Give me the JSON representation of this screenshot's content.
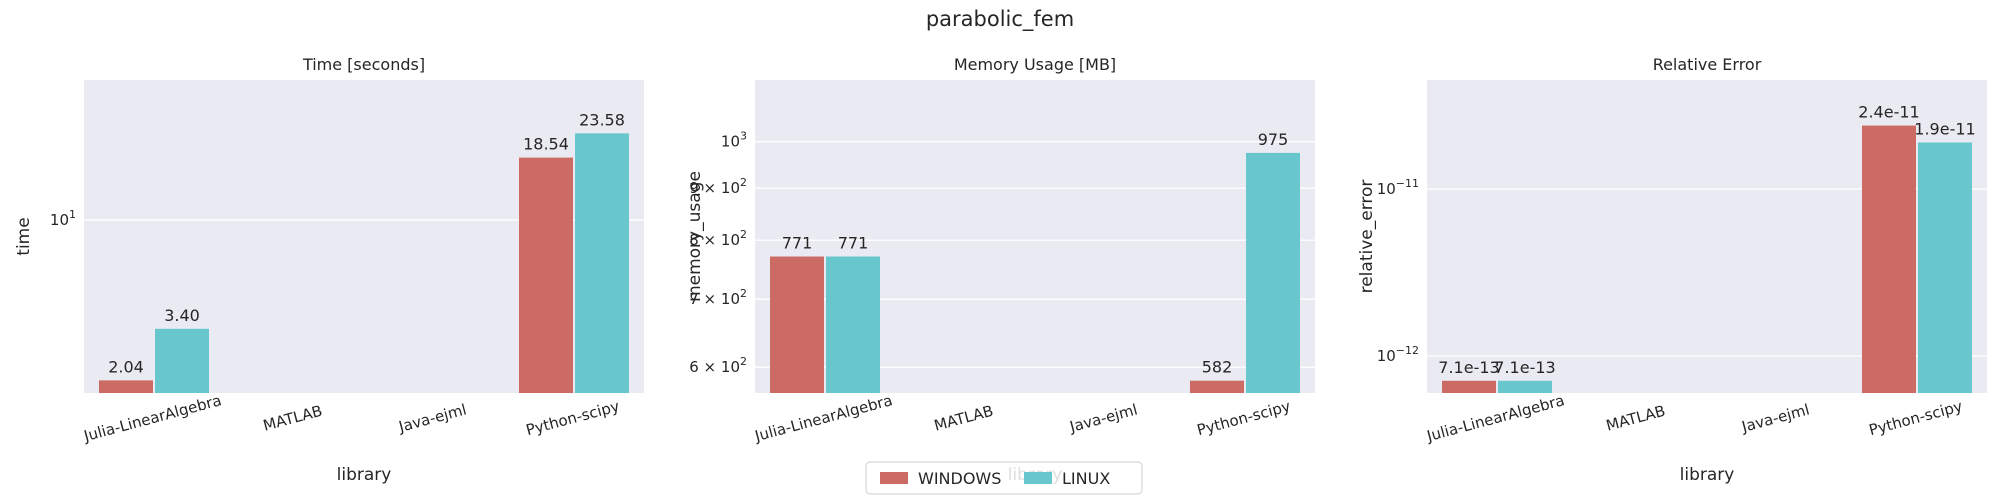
{
  "figure": {
    "suptitle": "parabolic_fem",
    "legend": {
      "placement": "bottom-center",
      "entries": [
        "WINDOWS",
        "LINUX"
      ]
    }
  },
  "colors": {
    "WINDOWS": "#cb6b63",
    "LINUX": "#67c7cc",
    "panel_bg": "#eaeaf2",
    "grid": "#ffffff"
  },
  "chart_data": [
    {
      "type": "bar",
      "title": "Time [seconds]",
      "xlabel": "library",
      "ylabel": "time",
      "yscale": "log",
      "categories": [
        "Julia-LinearAlgebra",
        "MATLAB",
        "Java-ejml",
        "Python-scipy"
      ],
      "series": [
        {
          "name": "WINDOWS",
          "values": [
            2.04,
            null,
            null,
            18.54
          ],
          "labels": [
            "2.04",
            "",
            "",
            "18.54"
          ]
        },
        {
          "name": "LINUX",
          "values": [
            3.4,
            null,
            null,
            23.58
          ],
          "labels": [
            "3.40",
            "",
            "",
            "23.58"
          ]
        }
      ],
      "yticks": [
        {
          "value": 10,
          "base": "10",
          "exp": "1"
        }
      ],
      "ylim": [
        1.8,
        40
      ],
      "grid": true
    },
    {
      "type": "bar",
      "title": "Memory Usage [MB]",
      "xlabel": "library",
      "ylabel": "memory_usage",
      "yscale": "log",
      "categories": [
        "Julia-LinearAlgebra",
        "MATLAB",
        "Java-ejml",
        "Python-scipy"
      ],
      "series": [
        {
          "name": "WINDOWS",
          "values": [
            771,
            null,
            null,
            582
          ],
          "labels": [
            "771",
            "",
            "",
            "582"
          ]
        },
        {
          "name": "LINUX",
          "values": [
            771,
            null,
            null,
            975
          ],
          "labels": [
            "771",
            "",
            "",
            "975"
          ]
        }
      ],
      "yticks": [
        {
          "value": 600,
          "base": "6 × 10",
          "exp": "2"
        },
        {
          "value": 700,
          "base": "7 × 10",
          "exp": "2"
        },
        {
          "value": 800,
          "base": "8 × 10",
          "exp": "2"
        },
        {
          "value": 900,
          "base": "9 × 10",
          "exp": "2"
        },
        {
          "value": 1000,
          "base": "10",
          "exp": "3"
        }
      ],
      "ylim": [
        566,
        1150
      ],
      "grid": true
    },
    {
      "type": "bar",
      "title": "Relative Error",
      "xlabel": "library",
      "ylabel": "relative_error",
      "yscale": "log",
      "categories": [
        "Julia-LinearAlgebra",
        "MATLAB",
        "Java-ejml",
        "Python-scipy"
      ],
      "series": [
        {
          "name": "WINDOWS",
          "values": [
            7.1e-13,
            null,
            null,
            2.4e-11
          ],
          "labels": [
            "7.1e-13",
            "",
            "",
            "2.4e-11"
          ]
        },
        {
          "name": "LINUX",
          "values": [
            7.1e-13,
            null,
            null,
            1.9e-11
          ],
          "labels": [
            "7.1e-13",
            "",
            "",
            "1.9e-11"
          ]
        }
      ],
      "yticks": [
        {
          "value": 1e-12,
          "base": "10",
          "exp": "−12"
        },
        {
          "value": 1e-11,
          "base": "10",
          "exp": "−11"
        }
      ],
      "ylim": [
        6e-13,
        4.5e-11
      ],
      "grid": true
    }
  ]
}
